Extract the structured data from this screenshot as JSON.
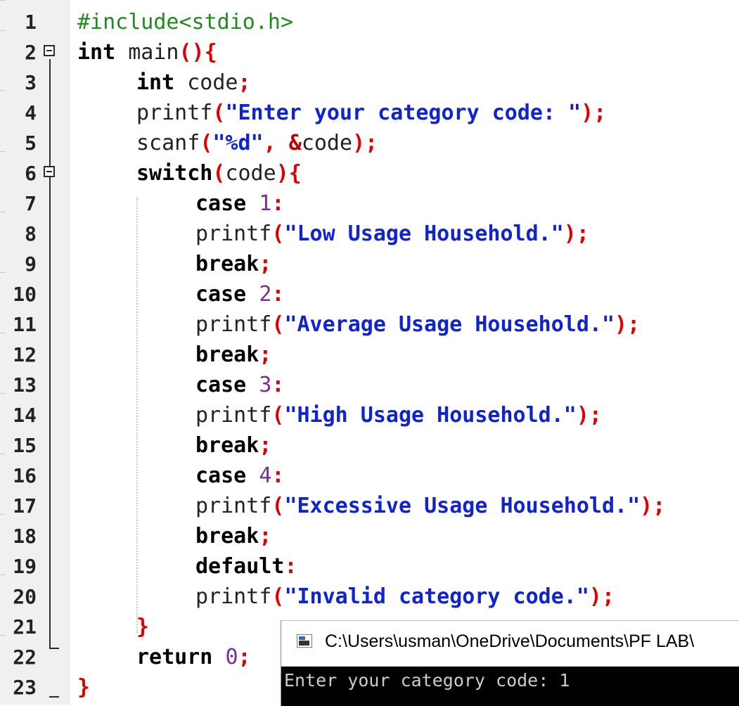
{
  "editor": {
    "lines": [
      {
        "number": "1",
        "tokens": [
          {
            "t": "#include<stdio.h>",
            "c": "pre"
          }
        ]
      },
      {
        "number": "2",
        "tokens": [
          {
            "t": "int",
            "c": "kw"
          },
          {
            "t": " main",
            "c": "id"
          },
          {
            "t": "(){",
            "c": "sym"
          }
        ]
      },
      {
        "number": "3",
        "tokens": [
          {
            "t": "int",
            "c": "kw"
          },
          {
            "t": " code",
            "c": "id"
          },
          {
            "t": ";",
            "c": "sym"
          }
        ]
      },
      {
        "number": "4",
        "tokens": [
          {
            "t": "printf",
            "c": "id"
          },
          {
            "t": "(",
            "c": "sym"
          },
          {
            "t": "\"Enter your category code: \"",
            "c": "str"
          },
          {
            "t": ");",
            "c": "sym"
          }
        ]
      },
      {
        "number": "5",
        "tokens": [
          {
            "t": "scanf",
            "c": "id"
          },
          {
            "t": "(",
            "c": "sym"
          },
          {
            "t": "\"%d\"",
            "c": "fmt"
          },
          {
            "t": ", ",
            "c": "sym"
          },
          {
            "t": "&",
            "c": "amp"
          },
          {
            "t": "code",
            "c": "id"
          },
          {
            "t": ");",
            "c": "sym"
          }
        ]
      },
      {
        "number": "6",
        "tokens": [
          {
            "t": "switch",
            "c": "kw"
          },
          {
            "t": "(",
            "c": "sym"
          },
          {
            "t": "code",
            "c": "id"
          },
          {
            "t": "){",
            "c": "sym"
          }
        ]
      },
      {
        "number": "7",
        "tokens": [
          {
            "t": "case",
            "c": "kw"
          },
          {
            "t": " ",
            "c": "id"
          },
          {
            "t": "1",
            "c": "num"
          },
          {
            "t": ":",
            "c": "sym"
          }
        ]
      },
      {
        "number": "8",
        "tokens": [
          {
            "t": "printf",
            "c": "id"
          },
          {
            "t": "(",
            "c": "sym"
          },
          {
            "t": "\"Low Usage Household.\"",
            "c": "str"
          },
          {
            "t": ");",
            "c": "sym"
          }
        ]
      },
      {
        "number": "9",
        "tokens": [
          {
            "t": "break",
            "c": "kw"
          },
          {
            "t": ";",
            "c": "sym"
          }
        ]
      },
      {
        "number": "10",
        "tokens": [
          {
            "t": "case",
            "c": "kw"
          },
          {
            "t": " ",
            "c": "id"
          },
          {
            "t": "2",
            "c": "num"
          },
          {
            "t": ":",
            "c": "sym"
          }
        ]
      },
      {
        "number": "11",
        "tokens": [
          {
            "t": "printf",
            "c": "id"
          },
          {
            "t": "(",
            "c": "sym"
          },
          {
            "t": "\"Average Usage Household.\"",
            "c": "str"
          },
          {
            "t": ");",
            "c": "sym"
          }
        ]
      },
      {
        "number": "12",
        "tokens": [
          {
            "t": "break",
            "c": "kw"
          },
          {
            "t": ";",
            "c": "sym"
          }
        ]
      },
      {
        "number": "13",
        "tokens": [
          {
            "t": "case",
            "c": "kw"
          },
          {
            "t": " ",
            "c": "id"
          },
          {
            "t": "3",
            "c": "num"
          },
          {
            "t": ":",
            "c": "sym"
          }
        ]
      },
      {
        "number": "14",
        "tokens": [
          {
            "t": "printf",
            "c": "id"
          },
          {
            "t": "(",
            "c": "sym"
          },
          {
            "t": "\"High Usage Household.\"",
            "c": "str"
          },
          {
            "t": ");",
            "c": "sym"
          }
        ]
      },
      {
        "number": "15",
        "tokens": [
          {
            "t": "break",
            "c": "kw"
          },
          {
            "t": ";",
            "c": "sym"
          }
        ]
      },
      {
        "number": "16",
        "tokens": [
          {
            "t": "case",
            "c": "kw"
          },
          {
            "t": " ",
            "c": "id"
          },
          {
            "t": "4",
            "c": "num"
          },
          {
            "t": ":",
            "c": "sym"
          }
        ]
      },
      {
        "number": "17",
        "tokens": [
          {
            "t": "printf",
            "c": "id"
          },
          {
            "t": "(",
            "c": "sym"
          },
          {
            "t": "\"Excessive Usage Household.\"",
            "c": "str"
          },
          {
            "t": ");",
            "c": "sym"
          }
        ]
      },
      {
        "number": "18",
        "tokens": [
          {
            "t": "break",
            "c": "kw"
          },
          {
            "t": ";",
            "c": "sym"
          }
        ]
      },
      {
        "number": "19",
        "tokens": [
          {
            "t": "default",
            "c": "kw"
          },
          {
            "t": ":",
            "c": "sym"
          }
        ]
      },
      {
        "number": "20",
        "tokens": [
          {
            "t": "printf",
            "c": "id"
          },
          {
            "t": "(",
            "c": "sym"
          },
          {
            "t": "\"Invalid category code.\"",
            "c": "str"
          },
          {
            "t": ");",
            "c": "sym"
          }
        ]
      },
      {
        "number": "21",
        "tokens": [
          {
            "t": "}",
            "c": "sym"
          }
        ]
      },
      {
        "number": "22",
        "tokens": [
          {
            "t": "return",
            "c": "kw"
          },
          {
            "t": " ",
            "c": "id"
          },
          {
            "t": "0",
            "c": "num"
          },
          {
            "t": ";",
            "c": "sym"
          }
        ]
      },
      {
        "number": "23",
        "tokens": [
          {
            "t": "}",
            "c": "sym"
          }
        ]
      }
    ]
  },
  "console": {
    "title": "C:\\Users\\usman\\OneDrive\\Documents\\PF LAB\\",
    "output": "Enter your category code: 1",
    "icon": "console-window-icon"
  },
  "colors": {
    "preprocessor": "#1e8b1e",
    "keyword": "#000000",
    "symbol": "#e00000",
    "string": "#0f23d0",
    "number": "#7a2f95",
    "console_bg": "#000000"
  }
}
